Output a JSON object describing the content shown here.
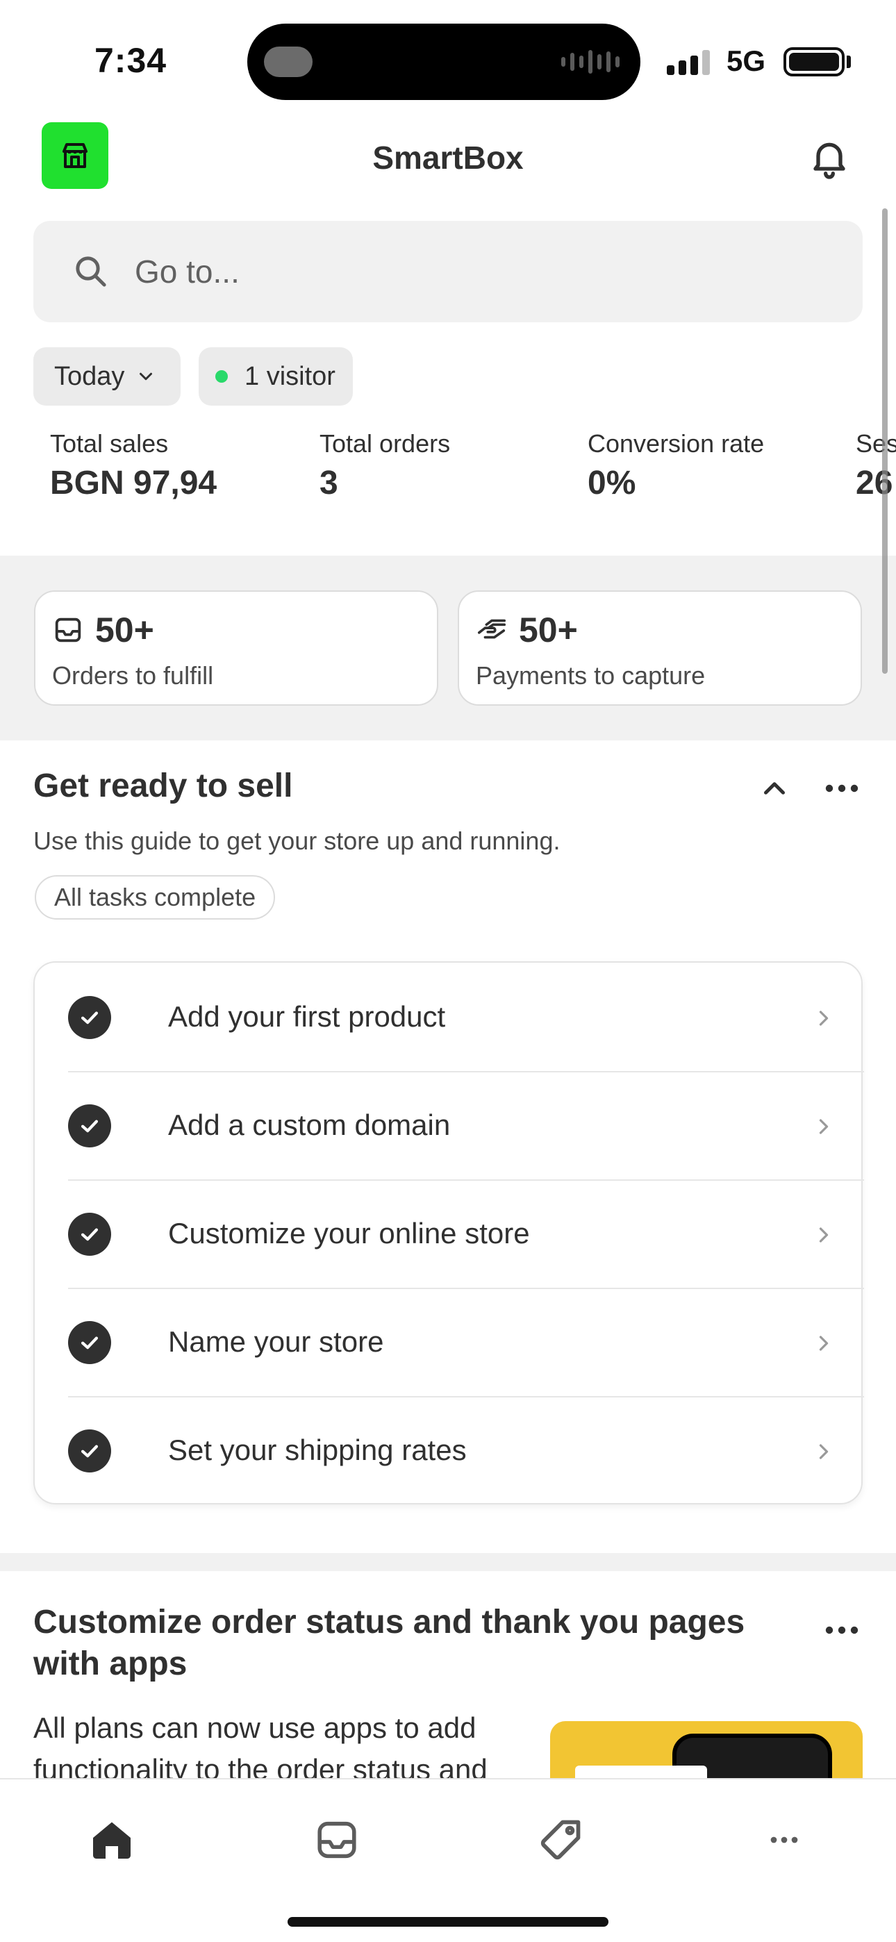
{
  "status_bar": {
    "time": "7:34",
    "network": "5G"
  },
  "header": {
    "title": "SmartBox",
    "logo_color": "#20e02f",
    "logo_icon": "store-icon",
    "bell_icon": "bell-icon"
  },
  "search": {
    "placeholder": "Go to..."
  },
  "filters": {
    "period": "Today",
    "visitors": "1 visitor",
    "live_dot_color": "#29d96a"
  },
  "metrics": [
    {
      "label": "Total sales",
      "value": "BGN 97,94"
    },
    {
      "label": "Total orders",
      "value": "3"
    },
    {
      "label": "Conversion rate",
      "value": "0%"
    },
    {
      "label": "Ses",
      "value": "26"
    }
  ],
  "cards": [
    {
      "value": "50+",
      "label": "Orders to fulfill",
      "icon": "inbox-icon"
    },
    {
      "value": "50+",
      "label": "Payments to capture",
      "icon": "hand-money-icon"
    }
  ],
  "guide": {
    "title": "Get ready to sell",
    "subtitle": "Use this guide to get your store up and running.",
    "status": "All tasks complete",
    "tasks": [
      {
        "label": "Add your first product",
        "done": true
      },
      {
        "label": "Add a custom domain",
        "done": true
      },
      {
        "label": "Customize your online store",
        "done": true
      },
      {
        "label": "Name your store",
        "done": true
      },
      {
        "label": "Set your shipping rates",
        "done": true
      }
    ]
  },
  "apps_card": {
    "title": "Customize order status and thank you pages with apps",
    "body": "All plans can now use apps to add functionality to the order status and",
    "image_color": "#f2c533"
  },
  "tabbar": {
    "items": [
      "home-icon",
      "inbox-icon",
      "tag-icon",
      "more-icon"
    ]
  }
}
